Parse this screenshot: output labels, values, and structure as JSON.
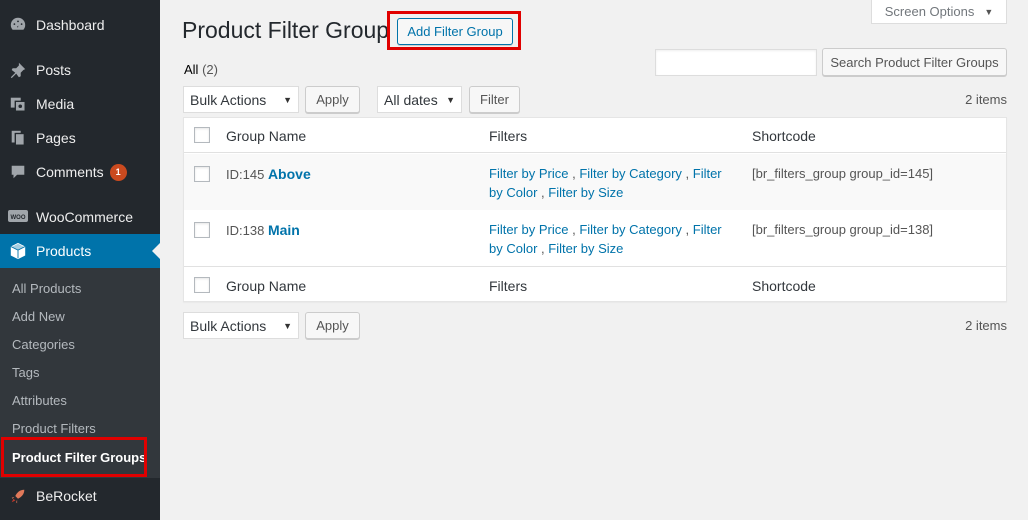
{
  "sidebar": {
    "items": [
      {
        "label": "Dashboard",
        "icon": "dashboard-icon"
      },
      {
        "label": "Posts",
        "icon": "pin-icon"
      },
      {
        "label": "Media",
        "icon": "media-icon"
      },
      {
        "label": "Pages",
        "icon": "pages-icon"
      },
      {
        "label": "Comments",
        "icon": "comment-icon",
        "badge": "1"
      },
      {
        "label": "WooCommerce",
        "icon": "woo-icon"
      },
      {
        "label": "Products",
        "icon": "box-icon"
      },
      {
        "label": "BeRocket",
        "icon": "rocket-icon"
      }
    ],
    "submenu": [
      "All Products",
      "Add New",
      "Categories",
      "Tags",
      "Attributes",
      "Product Filters",
      "Product Filter Groups"
    ]
  },
  "header": {
    "title": "Product Filter Group",
    "add_button": "Add Filter Group",
    "screen_options": "Screen Options"
  },
  "views": {
    "all_label": "All",
    "all_count": "(2)"
  },
  "search": {
    "button": "Search Product Filter Groups",
    "value": ""
  },
  "tablenav": {
    "bulk_actions": "Bulk Actions",
    "apply": "Apply",
    "dates": "All dates",
    "filter": "Filter",
    "items_count": "2 items"
  },
  "table": {
    "columns": [
      "Group Name",
      "Filters",
      "Shortcode"
    ],
    "rows": [
      {
        "id_prefix": "ID:145",
        "name": "Above",
        "filters": [
          "Filter by Price",
          "Filter by Category",
          "Filter by Color",
          "Filter by Size"
        ],
        "shortcode": "[br_filters_group group_id=145]"
      },
      {
        "id_prefix": "ID:138",
        "name": "Main",
        "filters": [
          "Filter by Price",
          "Filter by Category",
          "Filter by Color",
          "Filter by Size"
        ],
        "shortcode": "[br_filters_group group_id=138]"
      }
    ]
  },
  "colors": {
    "accent": "#0073aa",
    "highlight": "#e00000",
    "sidebar_bg": "#23282d"
  }
}
